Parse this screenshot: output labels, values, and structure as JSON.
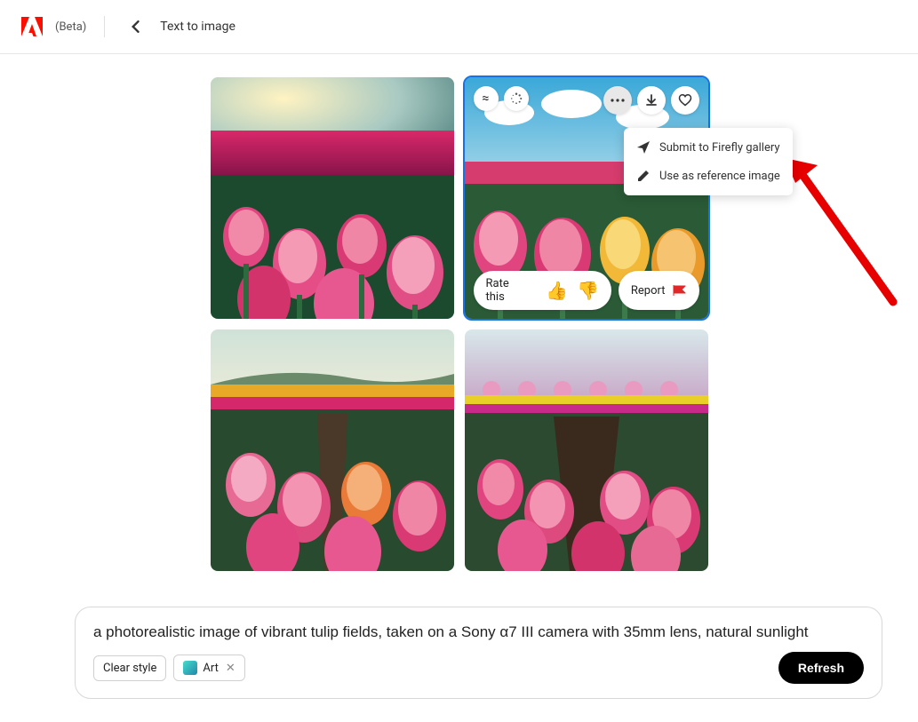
{
  "header": {
    "beta_label": "(Beta)",
    "page_title": "Text to image"
  },
  "tile_overlay": {
    "rate_label": "Rate this",
    "thumbs_up": "👍",
    "thumbs_down": "👎",
    "report_label": "Report"
  },
  "menu": {
    "submit_label": "Submit to Firefly gallery",
    "reference_label": "Use as reference image"
  },
  "prompt": {
    "text": "a photorealistic image of vibrant tulip fields, taken on a Sony α7 III camera with 35mm lens, natural sunlight",
    "clear_style_label": "Clear style",
    "style_tag_label": "Art",
    "refresh_label": "Refresh"
  }
}
